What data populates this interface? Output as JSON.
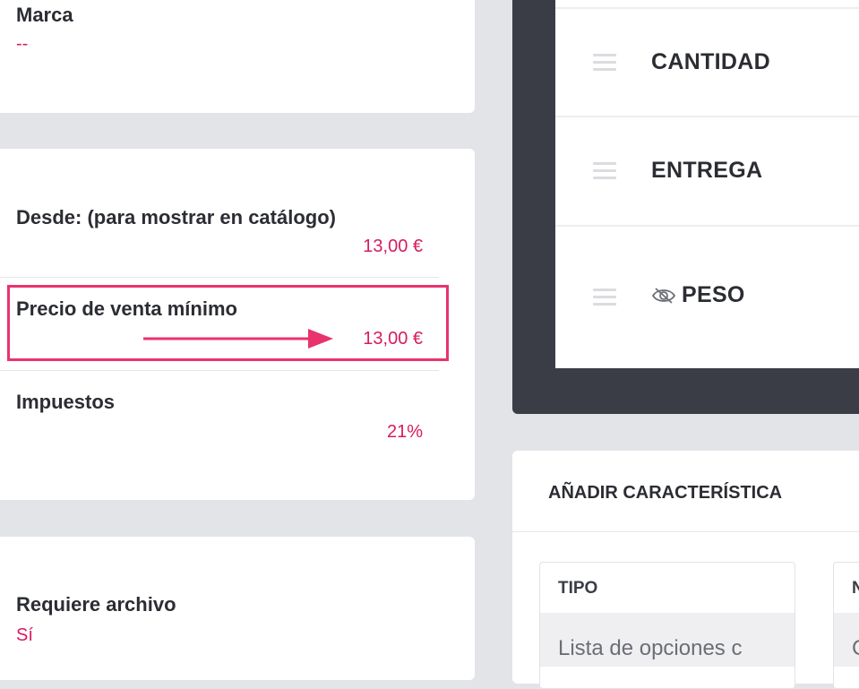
{
  "brand": {
    "label": "Marca",
    "value": "--"
  },
  "pricing": {
    "from_label": "Desde: (para mostrar en catálogo)",
    "from_value": "13,00 €",
    "min_label": "Precio de venta mínimo",
    "min_value": "13,00 €",
    "tax_label": "Impuestos",
    "tax_value": "21%"
  },
  "file": {
    "label": "Requiere archivo",
    "value": "Sí"
  },
  "features": [
    {
      "label": "CANTIDAD",
      "hidden": false
    },
    {
      "label": "ENTREGA",
      "hidden": false
    },
    {
      "label": "PESO",
      "hidden": true
    }
  ],
  "add_feature": {
    "title": "AÑADIR CARACTERÍSTICA",
    "type_label": "TIPO",
    "type_value": "Lista de opciones c",
    "second_label": "N",
    "second_value": "C"
  },
  "colors": {
    "accent": "#d81b60",
    "highlight": "#e8336d",
    "dark_panel": "#3a3d45"
  }
}
